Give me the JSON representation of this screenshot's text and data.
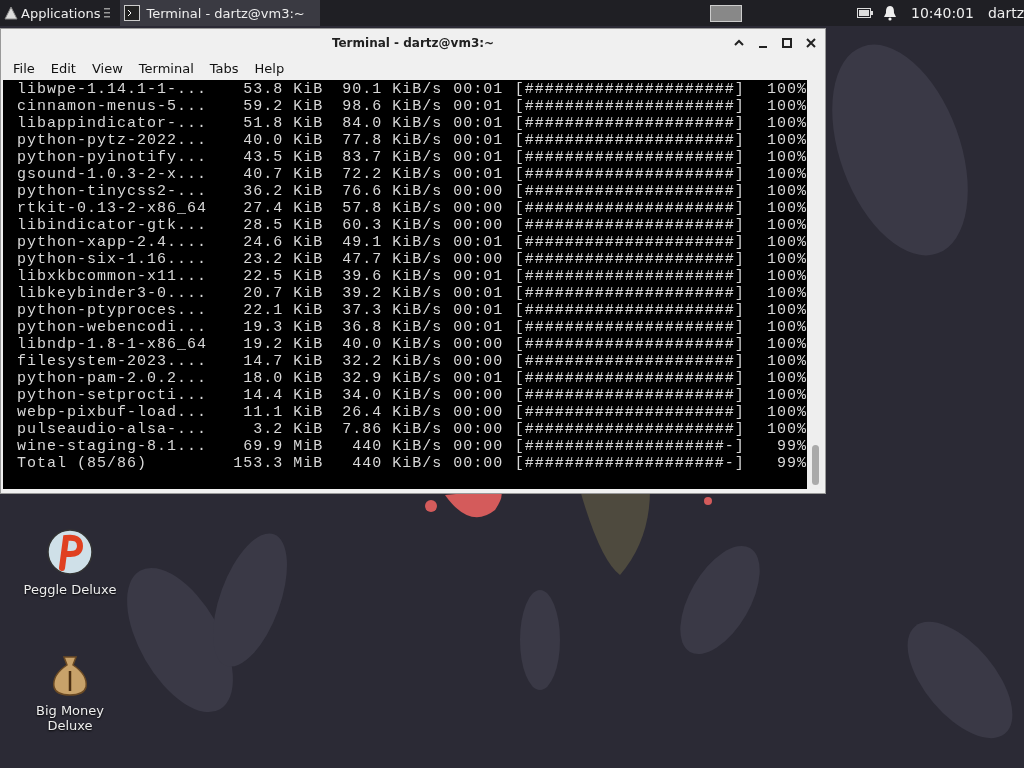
{
  "top_panel": {
    "applications": "Applications",
    "tasks": [
      {
        "title": "Terminal - dartz@vm3:~",
        "selected": true
      }
    ],
    "clock": "10:40:01",
    "user": "dartz"
  },
  "window": {
    "title": "Terminal - dartz@vm3:~",
    "menu": [
      "File",
      "Edit",
      "View",
      "Terminal",
      "Tabs",
      "Help"
    ],
    "rows": [
      {
        "name": "libwpe-1.14.1-1-...",
        "size": "53.8 KiB",
        "speed": "90.1 KiB/s",
        "eta": "00:01",
        "progress": "[#####################]",
        "percent": "100%"
      },
      {
        "name": "cinnamon-menus-5...",
        "size": "59.2 KiB",
        "speed": "98.6 KiB/s",
        "eta": "00:01",
        "progress": "[#####################]",
        "percent": "100%"
      },
      {
        "name": "libappindicator-...",
        "size": "51.8 KiB",
        "speed": "84.0 KiB/s",
        "eta": "00:01",
        "progress": "[#####################]",
        "percent": "100%"
      },
      {
        "name": "python-pytz-2022...",
        "size": "40.0 KiB",
        "speed": "77.8 KiB/s",
        "eta": "00:01",
        "progress": "[#####################]",
        "percent": "100%"
      },
      {
        "name": "python-pyinotify...",
        "size": "43.5 KiB",
        "speed": "83.7 KiB/s",
        "eta": "00:01",
        "progress": "[#####################]",
        "percent": "100%"
      },
      {
        "name": "gsound-1.0.3-2-x...",
        "size": "40.7 KiB",
        "speed": "72.2 KiB/s",
        "eta": "00:01",
        "progress": "[#####################]",
        "percent": "100%"
      },
      {
        "name": "python-tinycss2-...",
        "size": "36.2 KiB",
        "speed": "76.6 KiB/s",
        "eta": "00:00",
        "progress": "[#####################]",
        "percent": "100%"
      },
      {
        "name": "rtkit-0.13-2-x86_64",
        "size": "27.4 KiB",
        "speed": "57.8 KiB/s",
        "eta": "00:00",
        "progress": "[#####################]",
        "percent": "100%"
      },
      {
        "name": "libindicator-gtk...",
        "size": "28.5 KiB",
        "speed": "60.3 KiB/s",
        "eta": "00:00",
        "progress": "[#####################]",
        "percent": "100%"
      },
      {
        "name": "python-xapp-2.4....",
        "size": "24.6 KiB",
        "speed": "49.1 KiB/s",
        "eta": "00:01",
        "progress": "[#####################]",
        "percent": "100%"
      },
      {
        "name": "python-six-1.16....",
        "size": "23.2 KiB",
        "speed": "47.7 KiB/s",
        "eta": "00:00",
        "progress": "[#####################]",
        "percent": "100%"
      },
      {
        "name": "libxkbcommon-x11...",
        "size": "22.5 KiB",
        "speed": "39.6 KiB/s",
        "eta": "00:01",
        "progress": "[#####################]",
        "percent": "100%"
      },
      {
        "name": "libkeybinder3-0....",
        "size": "20.7 KiB",
        "speed": "39.2 KiB/s",
        "eta": "00:01",
        "progress": "[#####################]",
        "percent": "100%"
      },
      {
        "name": "python-ptyproces...",
        "size": "22.1 KiB",
        "speed": "37.3 KiB/s",
        "eta": "00:01",
        "progress": "[#####################]",
        "percent": "100%"
      },
      {
        "name": "python-webencodi...",
        "size": "19.3 KiB",
        "speed": "36.8 KiB/s",
        "eta": "00:01",
        "progress": "[#####################]",
        "percent": "100%"
      },
      {
        "name": "libndp-1.8-1-x86_64",
        "size": "19.2 KiB",
        "speed": "40.0 KiB/s",
        "eta": "00:00",
        "progress": "[#####################]",
        "percent": "100%"
      },
      {
        "name": "filesystem-2023....",
        "size": "14.7 KiB",
        "speed": "32.2 KiB/s",
        "eta": "00:00",
        "progress": "[#####################]",
        "percent": "100%"
      },
      {
        "name": "python-pam-2.0.2...",
        "size": "18.0 KiB",
        "speed": "32.9 KiB/s",
        "eta": "00:01",
        "progress": "[#####################]",
        "percent": "100%"
      },
      {
        "name": "python-setprocti...",
        "size": "14.4 KiB",
        "speed": "34.0 KiB/s",
        "eta": "00:00",
        "progress": "[#####################]",
        "percent": "100%"
      },
      {
        "name": "webp-pixbuf-load...",
        "size": "11.1 KiB",
        "speed": "26.4 KiB/s",
        "eta": "00:00",
        "progress": "[#####################]",
        "percent": "100%"
      },
      {
        "name": "pulseaudio-alsa-...",
        "size": "3.2 KiB",
        "speed": "7.86 KiB/s",
        "eta": "00:00",
        "progress": "[#####################]",
        "percent": "100%"
      },
      {
        "name": "wine-staging-8.1...",
        "size": "69.9 MiB",
        "speed": "440 KiB/s",
        "eta": "00:00",
        "progress": "[####################-]",
        "percent": "99%"
      },
      {
        "name": "Total (85/86)",
        "size": "153.3 MiB",
        "speed": "440 KiB/s",
        "eta": "00:00",
        "progress": "[####################-]",
        "percent": "99%"
      }
    ]
  },
  "desktop_icons": [
    {
      "label": "Peggle Deluxe",
      "kind": "ball"
    },
    {
      "label": "Big Money Deluxe",
      "kind": "bag"
    }
  ]
}
